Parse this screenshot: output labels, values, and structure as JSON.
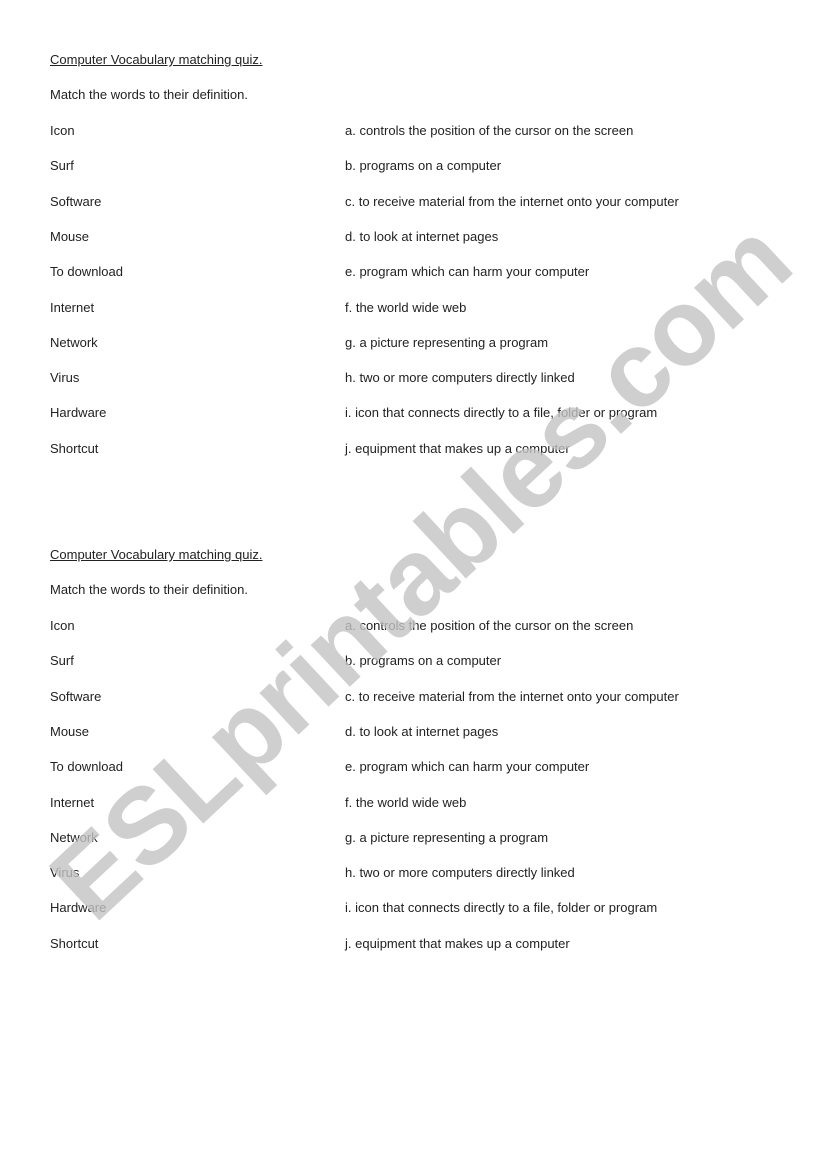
{
  "quiz": {
    "title": "Computer Vocabulary matching quiz.",
    "instructions": "Match the words to their definition.",
    "words": [
      "Icon",
      "Surf",
      "Software",
      "Mouse",
      "To download",
      "Internet",
      "Network",
      "Virus",
      "Hardware",
      "Shortcut"
    ],
    "definitions": [
      "a. controls the position of the cursor on the screen",
      "b. programs on a computer",
      "c. to receive material from the internet onto your computer",
      "d. to look at internet pages",
      "e. program which can harm your computer",
      "f.  the world wide web",
      "g. a picture representing a program",
      "h. two or more computers directly linked",
      "i. icon that connects directly to a file, folder or program",
      "j. equipment that makes up a computer"
    ]
  },
  "watermark": "ESLprintables.com"
}
